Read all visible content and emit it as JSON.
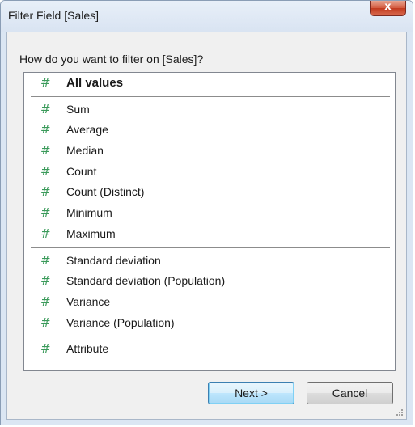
{
  "window": {
    "title": "Filter Field [Sales]",
    "close_symbol": "x"
  },
  "prompt": "How do you want to filter on [Sales]?",
  "icon_glyph": "#",
  "groups": [
    {
      "items": [
        {
          "label": "All values",
          "icon": "hash-icon"
        }
      ]
    },
    {
      "items": [
        {
          "label": "Sum",
          "icon": "hash-icon"
        },
        {
          "label": "Average",
          "icon": "hash-icon"
        },
        {
          "label": "Median",
          "icon": "hash-icon"
        },
        {
          "label": "Count",
          "icon": "hash-icon"
        },
        {
          "label": "Count (Distinct)",
          "icon": "hash-icon"
        },
        {
          "label": "Minimum",
          "icon": "hash-icon"
        },
        {
          "label": "Maximum",
          "icon": "hash-icon"
        }
      ]
    },
    {
      "items": [
        {
          "label": "Standard deviation",
          "icon": "hash-icon"
        },
        {
          "label": "Standard deviation (Population)",
          "icon": "hash-icon"
        },
        {
          "label": "Variance",
          "icon": "hash-icon"
        },
        {
          "label": "Variance (Population)",
          "icon": "hash-icon"
        }
      ]
    },
    {
      "items": [
        {
          "label": "Attribute",
          "icon": "hash-icon"
        }
      ]
    }
  ],
  "buttons": {
    "next_label": "Next >",
    "cancel_label": "Cancel"
  },
  "colors": {
    "hash_icon": "#3a9a5a",
    "close_button": "#c23a1e",
    "default_button_border": "#3c7fb1"
  }
}
